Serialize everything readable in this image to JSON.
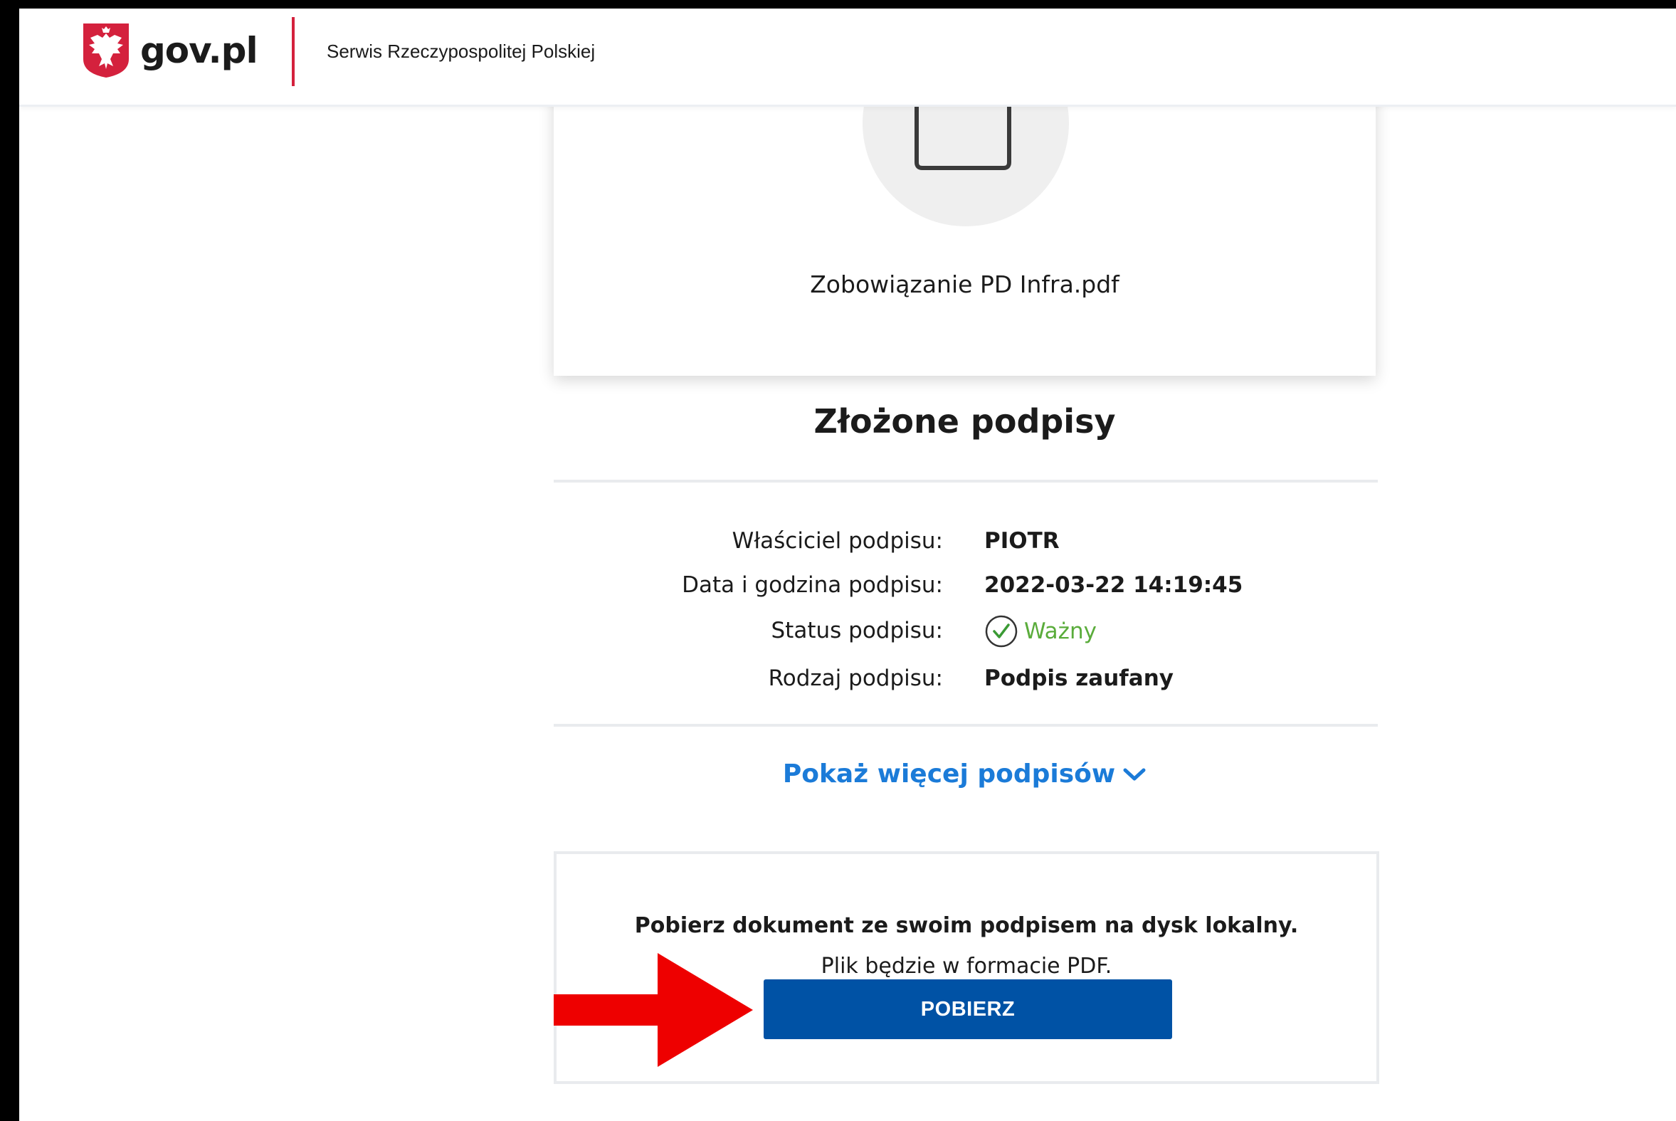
{
  "header": {
    "logo_text": "gov.pl",
    "subtitle": "Serwis Rzeczypospolitej Polskiej"
  },
  "file": {
    "name": "Zobowiązanie PD Infra.pdf"
  },
  "signatures": {
    "title": "Złożone podpisy",
    "rows": [
      {
        "label": "Właściciel podpisu:",
        "value": "PIOTR"
      },
      {
        "label": "Data i godzina podpisu:",
        "value": "2022-03-22 14:19:45"
      },
      {
        "label": "Status podpisu:",
        "value": "Ważny"
      },
      {
        "label": "Rodzaj podpisu:",
        "value": "Podpis zaufany"
      }
    ],
    "show_more": "Pokaż więcej podpisów"
  },
  "download": {
    "title": "Pobierz dokument ze swoim podpisem na dysk lokalny.",
    "subtitle": "Plik będzie w formacie PDF.",
    "button": "POBIERZ"
  },
  "colors": {
    "brand_red": "#d4213d",
    "primary_blue": "#0052a5",
    "link_blue": "#1b7bd8",
    "valid_green": "#5aac3b",
    "annotation_red": "#ee0000"
  },
  "icons": {
    "emblem": "polish-eagle-emblem-icon",
    "document": "signed-document-icon",
    "status": "check-circle-icon",
    "show_more": "chevron-down-icon"
  }
}
